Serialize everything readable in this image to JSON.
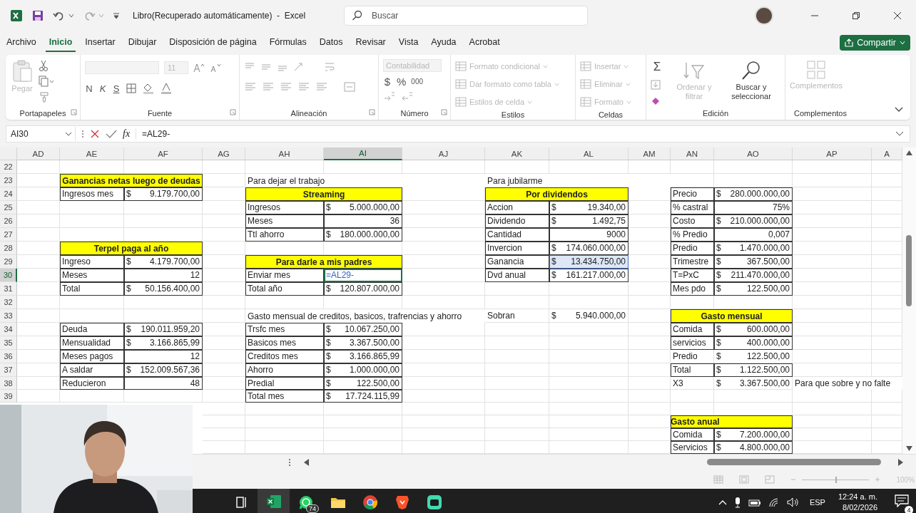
{
  "title_bar": {
    "title": "Libro(Recuperado automáticamente)  -  Excel",
    "search": {
      "placeholder": "Buscar"
    }
  },
  "menu": [
    {
      "label": "Archivo",
      "selected": false
    },
    {
      "label": "Inicio",
      "selected": true
    },
    {
      "label": "Insertar",
      "selected": false
    },
    {
      "label": "Dibujar",
      "selected": false
    },
    {
      "label": "Disposición de página",
      "selected": false
    },
    {
      "label": "Fórmulas",
      "selected": false
    },
    {
      "label": "Datos",
      "selected": false
    },
    {
      "label": "Revisar",
      "selected": false
    },
    {
      "label": "Vista",
      "selected": false
    },
    {
      "label": "Ayuda",
      "selected": false
    },
    {
      "label": "Acrobat",
      "selected": false
    }
  ],
  "share_button": {
    "label": "Compartir"
  },
  "ribbon": [
    {
      "label": "Portapapeles",
      "items": [
        {
          "label": "Pegar",
          "disabled": true
        }
      ]
    },
    {
      "label": "Fuente",
      "items": [
        {
          "label": "11",
          "disabled": true
        },
        {
          "label": "N",
          "disabled": false
        },
        {
          "label": "K",
          "disabled": false
        },
        {
          "label": "S",
          "disabled": false
        }
      ]
    },
    {
      "label": "Alineación"
    },
    {
      "label": "Número",
      "items": [
        {
          "label": "Contabilidad",
          "disabled": true
        },
        {
          "label": "$",
          "disabled": false
        },
        {
          "label": "%",
          "disabled": false
        },
        {
          "label": "000",
          "disabled": false
        }
      ]
    },
    {
      "label": "Estilos",
      "items": [
        {
          "label": "Formato condicional",
          "disabled": true
        },
        {
          "label": "Dar formato como tabla",
          "disabled": true
        },
        {
          "label": "Estilos de celda",
          "disabled": true
        }
      ]
    },
    {
      "label": "Celdas",
      "items": [
        {
          "label": "Insertar",
          "disabled": true
        },
        {
          "label": "Eliminar",
          "disabled": true
        },
        {
          "label": "Formato",
          "disabled": true
        }
      ]
    },
    {
      "label": "Edición",
      "items": [
        {
          "label": "Σ",
          "disabled": false
        },
        {
          "label": "Ordenar y filtrar",
          "disabled": true
        },
        {
          "label": "Buscar y seleccionar",
          "disabled": false
        }
      ]
    },
    {
      "label": "Complementos",
      "items": [
        {
          "label": "Complementos",
          "disabled": true
        }
      ]
    }
  ],
  "formula_bar": {
    "name_box": "AI30",
    "function_label": "fx",
    "formula": "=AL29-"
  },
  "sheet": {
    "columns": [
      {
        "label": "AD",
        "selected": false
      },
      {
        "label": "AE",
        "selected": false
      },
      {
        "label": "AF",
        "selected": false
      },
      {
        "label": "AG",
        "selected": false
      },
      {
        "label": "AH",
        "selected": false
      },
      {
        "label": "AI",
        "selected": true
      },
      {
        "label": "AJ",
        "selected": false
      },
      {
        "label": "AK",
        "selected": false
      },
      {
        "label": "AL",
        "selected": false
      },
      {
        "label": "AM",
        "selected": false
      },
      {
        "label": "AN",
        "selected": false
      },
      {
        "label": "AO",
        "selected": false
      },
      {
        "label": "AP",
        "selected": false
      },
      {
        "label": "A",
        "selected": false
      }
    ],
    "rows": [
      {
        "label": "22",
        "selected": false
      },
      {
        "label": "23",
        "selected": false
      },
      {
        "label": "24",
        "selected": false
      },
      {
        "label": "25",
        "selected": false
      },
      {
        "label": "26",
        "selected": false
      },
      {
        "label": "27",
        "selected": false
      },
      {
        "label": "28",
        "selected": false
      },
      {
        "label": "29",
        "selected": false
      },
      {
        "label": "30",
        "selected": true
      },
      {
        "label": "31",
        "selected": false
      },
      {
        "label": "32",
        "selected": false
      },
      {
        "label": "33",
        "selected": false
      },
      {
        "label": "34",
        "selected": false
      },
      {
        "label": "35",
        "selected": false
      },
      {
        "label": "36",
        "selected": false
      },
      {
        "label": "37",
        "selected": false
      },
      {
        "label": "38",
        "selected": false
      },
      {
        "label": "39",
        "selected": false
      }
    ],
    "tables": [
      {
        "header": "Ganancias netas luego de deudas",
        "rows": [
          {
            "label": "Ingresos mes",
            "symbol": "$",
            "value": "9.179.700,00",
            "bordered": true
          }
        ]
      },
      {
        "header": "Terpel paga al año",
        "rows": [
          {
            "label": "Ingreso",
            "symbol": "$",
            "value": "4.179.700,00",
            "bordered": true
          },
          {
            "label": "Meses",
            "value": "12",
            "bordered": true
          },
          {
            "label": "Total",
            "symbol": "$",
            "value": "50.156.400,00",
            "bordered": true
          }
        ]
      },
      {
        "rows": [
          {
            "label": "Deuda",
            "symbol": "$",
            "value": "190.011.959,20",
            "bordered": true
          },
          {
            "label": "Mensualidad",
            "symbol": "$",
            "value": "3.166.865,99",
            "bordered": true
          },
          {
            "label": "Meses pagos",
            "value": "12",
            "bordered": true
          },
          {
            "label": "A saldar",
            "symbol": "$",
            "value": "152.009.567,36",
            "bordered": true
          },
          {
            "label": "Reducieron",
            "value": "48",
            "bordered": true
          }
        ]
      },
      {
        "title": "Para dejar el trabajo",
        "header": "Streaming",
        "rows": [
          {
            "label": "Ingresos",
            "symbol": "$",
            "value": "5.000.000,00",
            "bordered": true
          },
          {
            "label": "Meses",
            "value": "36",
            "bordered": true
          },
          {
            "label": "Ttl ahorro",
            "symbol": "$",
            "value": "180.000.000,00",
            "bordered": true
          }
        ]
      },
      {
        "header": "Para darle a mis padres",
        "rows": [
          {
            "label": "Enviar mes",
            "value": "=AL29-",
            "bordered": true,
            "editing": true
          },
          {
            "label": "Total año",
            "symbol": "$",
            "value": "120.807.000,00",
            "bordered": true
          }
        ]
      },
      {
        "title": "Gasto mensual de creditos, basicos, trafrencias y ahorro",
        "rows": [
          {
            "label": "Trsfc mes",
            "symbol": "$",
            "value": "10.067.250,00",
            "bordered": true
          },
          {
            "label": "Basicos mes",
            "symbol": "$",
            "value": "3.367.500,00",
            "bordered": true
          },
          {
            "label": "Creditos mes",
            "symbol": "$",
            "value": "3.166.865,99",
            "bordered": true
          },
          {
            "label": "Ahorro",
            "symbol": "$",
            "value": "1.000.000,00",
            "bordered": true
          },
          {
            "label": "Predial",
            "symbol": "$",
            "value": "122.500,00",
            "bordered": true
          },
          {
            "label": "Total mes",
            "symbol": "$",
            "value": "17.724.115,99",
            "bordered": true
          }
        ]
      },
      {
        "title": "Para jubilarme",
        "header": "Por dividendos",
        "rows": [
          {
            "label": "Accion",
            "symbol": "$",
            "value": "19.340,00",
            "bordered": true
          },
          {
            "label": "Dividendo",
            "symbol": "$",
            "value": "1.492,75",
            "bordered": true
          },
          {
            "label": "Cantidad",
            "value": "9000",
            "bordered": true
          },
          {
            "label": "Invercion",
            "symbol": "$",
            "value": "174.060.000,00",
            "bordered": true
          },
          {
            "label": "Ganancia",
            "symbol": "$",
            "value": "13.434.750,00",
            "bordered": true,
            "referenced": true
          },
          {
            "label": "Dvd anual",
            "symbol": "$",
            "value": "161.217.000,00",
            "bordered": true
          }
        ]
      },
      {
        "rows": [
          {
            "label": "Sobran",
            "symbol": "$",
            "value": "5.940.000,00",
            "bordered": false
          }
        ]
      },
      {
        "rows": [
          {
            "label": "Precio",
            "symbol": "$",
            "value": "280.000.000,00",
            "bordered": true
          },
          {
            "label": "% castral",
            "value": "75%",
            "bordered": true
          },
          {
            "label": "Costo",
            "symbol": "$",
            "value": "210.000.000,00",
            "bordered": true
          },
          {
            "label": "% Predio",
            "value": "0,007",
            "bordered": true
          },
          {
            "label": "Predio",
            "symbol": "$",
            "value": "1.470.000,00",
            "bordered": true
          },
          {
            "label": "Trimestre",
            "symbol": "$",
            "value": "367.500,00",
            "bordered": true
          },
          {
            "label": "T=PxC",
            "symbol": "$",
            "value": "211.470.000,00",
            "bordered": true
          },
          {
            "label": "Mes pdo",
            "symbol": "$",
            "value": "122.500,00",
            "bordered": true
          }
        ]
      },
      {
        "header": "Gasto mensual",
        "rows": [
          {
            "label": "Comida",
            "symbol": "$",
            "value": "600.000,00",
            "bordered": true
          },
          {
            "label": "servicios",
            "symbol": "$",
            "value": "400.000,00",
            "bordered": true
          },
          {
            "label": "Predio",
            "symbol": "$",
            "value": "122.500,00",
            "bordered": false
          },
          {
            "label": "Total",
            "symbol": "$",
            "value": "1.122.500,00",
            "bordered": true
          },
          {
            "label": "X3",
            "symbol": "$",
            "value": "3.367.500,00",
            "bordered": false,
            "note": "Para que sobre y no falte"
          }
        ]
      },
      {
        "header": "Gasto anual",
        "left_aligned": true,
        "rows": [
          {
            "label": "Comida",
            "symbol": "$",
            "value": "7.200.000,00",
            "bordered": true
          },
          {
            "label": "Servicios",
            "symbol": "$",
            "value": "4.800.000,00",
            "bordered": true
          }
        ]
      }
    ]
  },
  "status_bar": {
    "zoom": {
      "label": "100%",
      "level": 0.5
    }
  },
  "taskbar": {
    "apps": [
      {
        "selected": false
      },
      {
        "selected": true
      },
      {
        "selected": false,
        "badge": "74"
      },
      {
        "selected": false
      },
      {
        "selected": false
      },
      {
        "selected": false
      },
      {
        "selected": false
      }
    ],
    "language": "ESP",
    "time": "12:24 a. m.",
    "date": "8/02/2026",
    "notifications": "4"
  }
}
